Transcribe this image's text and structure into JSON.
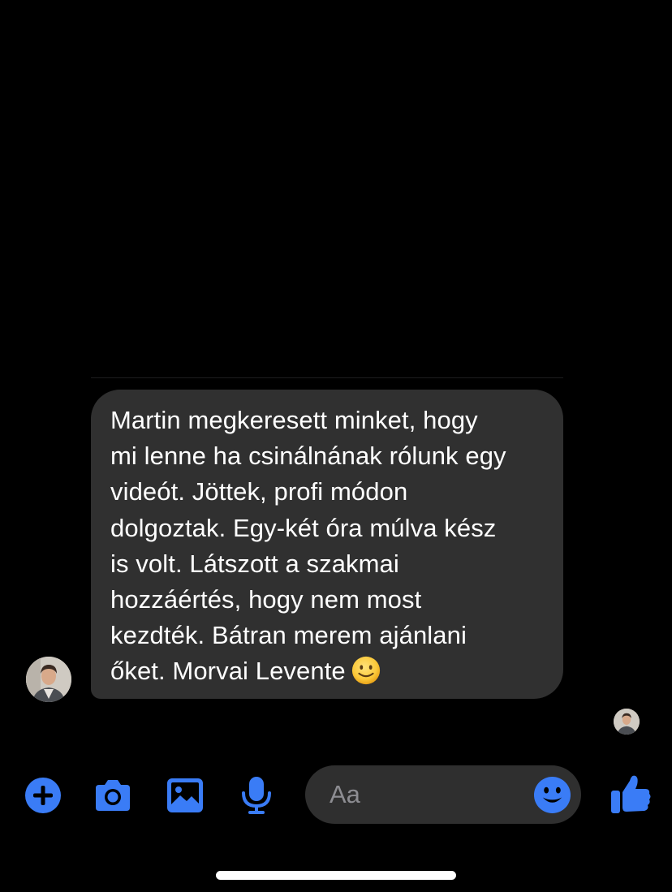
{
  "conversation": {
    "message": {
      "text": "Martin megkeresett minket, hogy\nmi lenne ha csinálnának rólunk egy\nvideót. Jöttek, profi módon\ndolgoztak. Egy-két óra múlva kész\nis volt. Látszott a szakmai\nhozzáértés, hogy nem most\nkezdték. Bátran merem ajánlani\nőket. Morvai Levente",
      "emoji": "slightly-smiling-face-icon"
    },
    "sender_avatar": "avatar",
    "read_receipt_avatar": "avatar"
  },
  "composer": {
    "placeholder": "Aa",
    "value": ""
  },
  "toolbar": {
    "icons": [
      "plus-circle-icon",
      "camera-icon",
      "photo-icon",
      "microphone-icon",
      "emoji-icon",
      "thumbs-up-icon"
    ]
  },
  "colors": {
    "accent": "#3a7cf6",
    "background": "#000000",
    "bubble": "#303030",
    "composer": "#2f2f2f",
    "placeholder": "#8d8d92"
  }
}
